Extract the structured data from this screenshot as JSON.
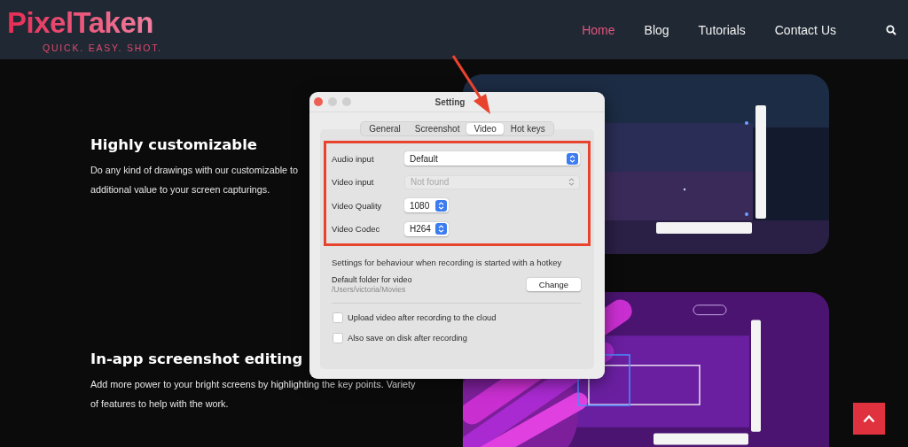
{
  "header": {
    "logo": "PixelTaken",
    "tagline": "QUICK. EASY. SHOT.",
    "nav": [
      {
        "label": "Home",
        "selected": true
      },
      {
        "label": "Blog",
        "selected": false
      },
      {
        "label": "Tutorials",
        "selected": false
      },
      {
        "label": "Contact Us",
        "selected": false
      }
    ]
  },
  "sections": [
    {
      "heading": "Highly customizable",
      "lines": [
        "Do any kind of drawings with our customizable to",
        "additional value to your screen capturings."
      ]
    },
    {
      "heading": "In-app screenshot editing",
      "lines": [
        "Add more power to your bright screens by highlighting the key points. Variety",
        "of features to help with the work."
      ]
    }
  ],
  "dialog": {
    "title": "Setting",
    "tabs": [
      {
        "label": "General",
        "selected": false
      },
      {
        "label": "Screenshot",
        "selected": false
      },
      {
        "label": "Video",
        "selected": true
      },
      {
        "label": "Hot keys",
        "selected": false
      }
    ],
    "fields": [
      {
        "label": "Audio input",
        "value": "Default",
        "kind": "wide",
        "disabled": false
      },
      {
        "label": "Video input",
        "value": "Not found",
        "kind": "wide",
        "disabled": true
      },
      {
        "label": "Video Quality",
        "value": "1080",
        "kind": "short",
        "disabled": false
      },
      {
        "label": "Video Codec",
        "value": "H264",
        "kind": "short",
        "disabled": false
      }
    ],
    "hotkey_note": "Settings for behaviour when recording is started with a hotkey",
    "folder": {
      "label": "Default folder for video",
      "path": "/Users/victoria/Movies",
      "button": "Change"
    },
    "checkboxes": [
      {
        "label": "Upload video after recording to the cloud",
        "checked": false
      },
      {
        "label": "Also save on disk after recording",
        "checked": false
      }
    ]
  }
}
